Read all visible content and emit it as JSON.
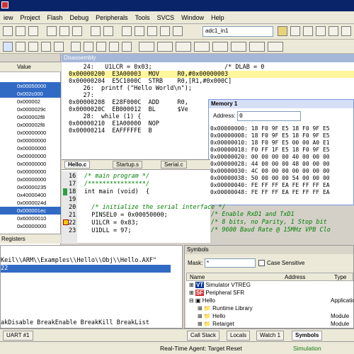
{
  "menu": [
    "iew",
    "Project",
    "Flash",
    "Debug",
    "Peripherals",
    "Tools",
    "SVCS",
    "Window",
    "Help"
  ],
  "toolbar": {
    "target_combo": "adc1_in1"
  },
  "left_panel": {
    "header_value": "Value",
    "rows": [
      "0x00050000",
      "0x002c000",
      "0x000002",
      "0x0000029c",
      "0x000002f8",
      "0x000002f8",
      "0x00000000",
      "0x00000000",
      "0x00000000",
      "0x00000000",
      "0x00000000",
      "0x00000000",
      "0x00000000",
      "0x00000235",
      "0x40000400",
      "0x0000024d",
      "0x000001ec",
      "0x60000010",
      "0x00000000"
    ],
    "tab_label": "Registers"
  },
  "disassembly": {
    "title": "Disassembly",
    "lines": [
      "    24:   U1LCR = 0x03;                    /* DLAB = 0",
      "0x00000200  E3A00003  MOV     R0,#0x00000003",
      "0x00000204  E5C1000C  STRB    R0,[R1,#0x000C]",
      "    26:  printf (\"Hello World\\n\");",
      "    27:",
      "0x00000208  E28F000C  ADD     R0,",
      "0x0000020C  EB000012  BL      $Ve",
      "    28:  while (1) {",
      "0x00000210  E1A00000  NOP",
      "0x00000214  EAFFFFFE  B"
    ]
  },
  "memory": {
    "title": "Memory 1",
    "address_label": "Address:",
    "address_value": "0",
    "lines": [
      "0x00000000: 18 F0 9F E5 18 F0 9F E5",
      "0x00000008: 18 F0 9F E5 18 F0 9F E5",
      "0x00000010: 18 F0 9F E5 00 00 A0 E1",
      "0x00000018: F0 FF 1F E5 18 F0 9F E5",
      "0x00000020: 00 00 00 00 40 00 00 00",
      "0x00000028: 44 00 00 00 48 00 00 00",
      "0x00000030: 4C 00 00 00 00 00 00 00",
      "0x00000038: 50 00 00 00 54 00 00 00",
      "0x00000040: FE FF FF EA FE FF FF EA",
      "0x00000048: FE FF FF EA FE FF FF EA"
    ]
  },
  "editor": {
    "tabs": [
      "Hello.c",
      "Startup.s",
      "Serial.c"
    ],
    "line_numbers": [
      "16",
      "17",
      "18",
      "19",
      "20",
      "21",
      "22",
      "23"
    ],
    "lines": [
      "/* main program */",
      "/****************/",
      "int main (void)  {",
      "",
      "  /* initialize the serial interface */",
      "  PINSEL0 = 0x00050000;",
      "  U1LCR = 0x83;",
      "  U1DLL = 97;"
    ],
    "right_comments": [
      "/* Enable RxD1 and TxD1",
      "/* 8 bits, no Parity, 1 Stop bit",
      "/* 9600 Baud Rate @ 15MHz VPB Clo"
    ]
  },
  "command": {
    "lines": [
      "Keil\\\\ARM\\\\Examples\\\\Hello\\\\Obj\\\\Hello.AXF\"",
      "22"
    ],
    "prompt": "akDisable BreakEnable BreakKill BreakList"
  },
  "symbols": {
    "title": "Symbols",
    "mask_label": "Mask:",
    "mask_value": "*",
    "case_label": "Case Sensitive",
    "columns": [
      "Name",
      "Address",
      "Type"
    ],
    "tree": [
      {
        "name": "Simulator VTREG",
        "type": ""
      },
      {
        "name": "Peripheral SFR",
        "type": ""
      },
      {
        "name": "Hello",
        "type": "Applicatio"
      },
      {
        "name": "Runtime Library",
        "type": ""
      },
      {
        "name": "Hello",
        "type": "Module"
      },
      {
        "name": "Retarget",
        "type": "Module"
      }
    ]
  },
  "bottom_tabs": [
    "UART #1",
    "Call Stack",
    "Locals",
    "Watch 1",
    "Symbols"
  ],
  "status": {
    "agent": "Real-Time Agent: Target Reset",
    "mode": "Simulation"
  }
}
